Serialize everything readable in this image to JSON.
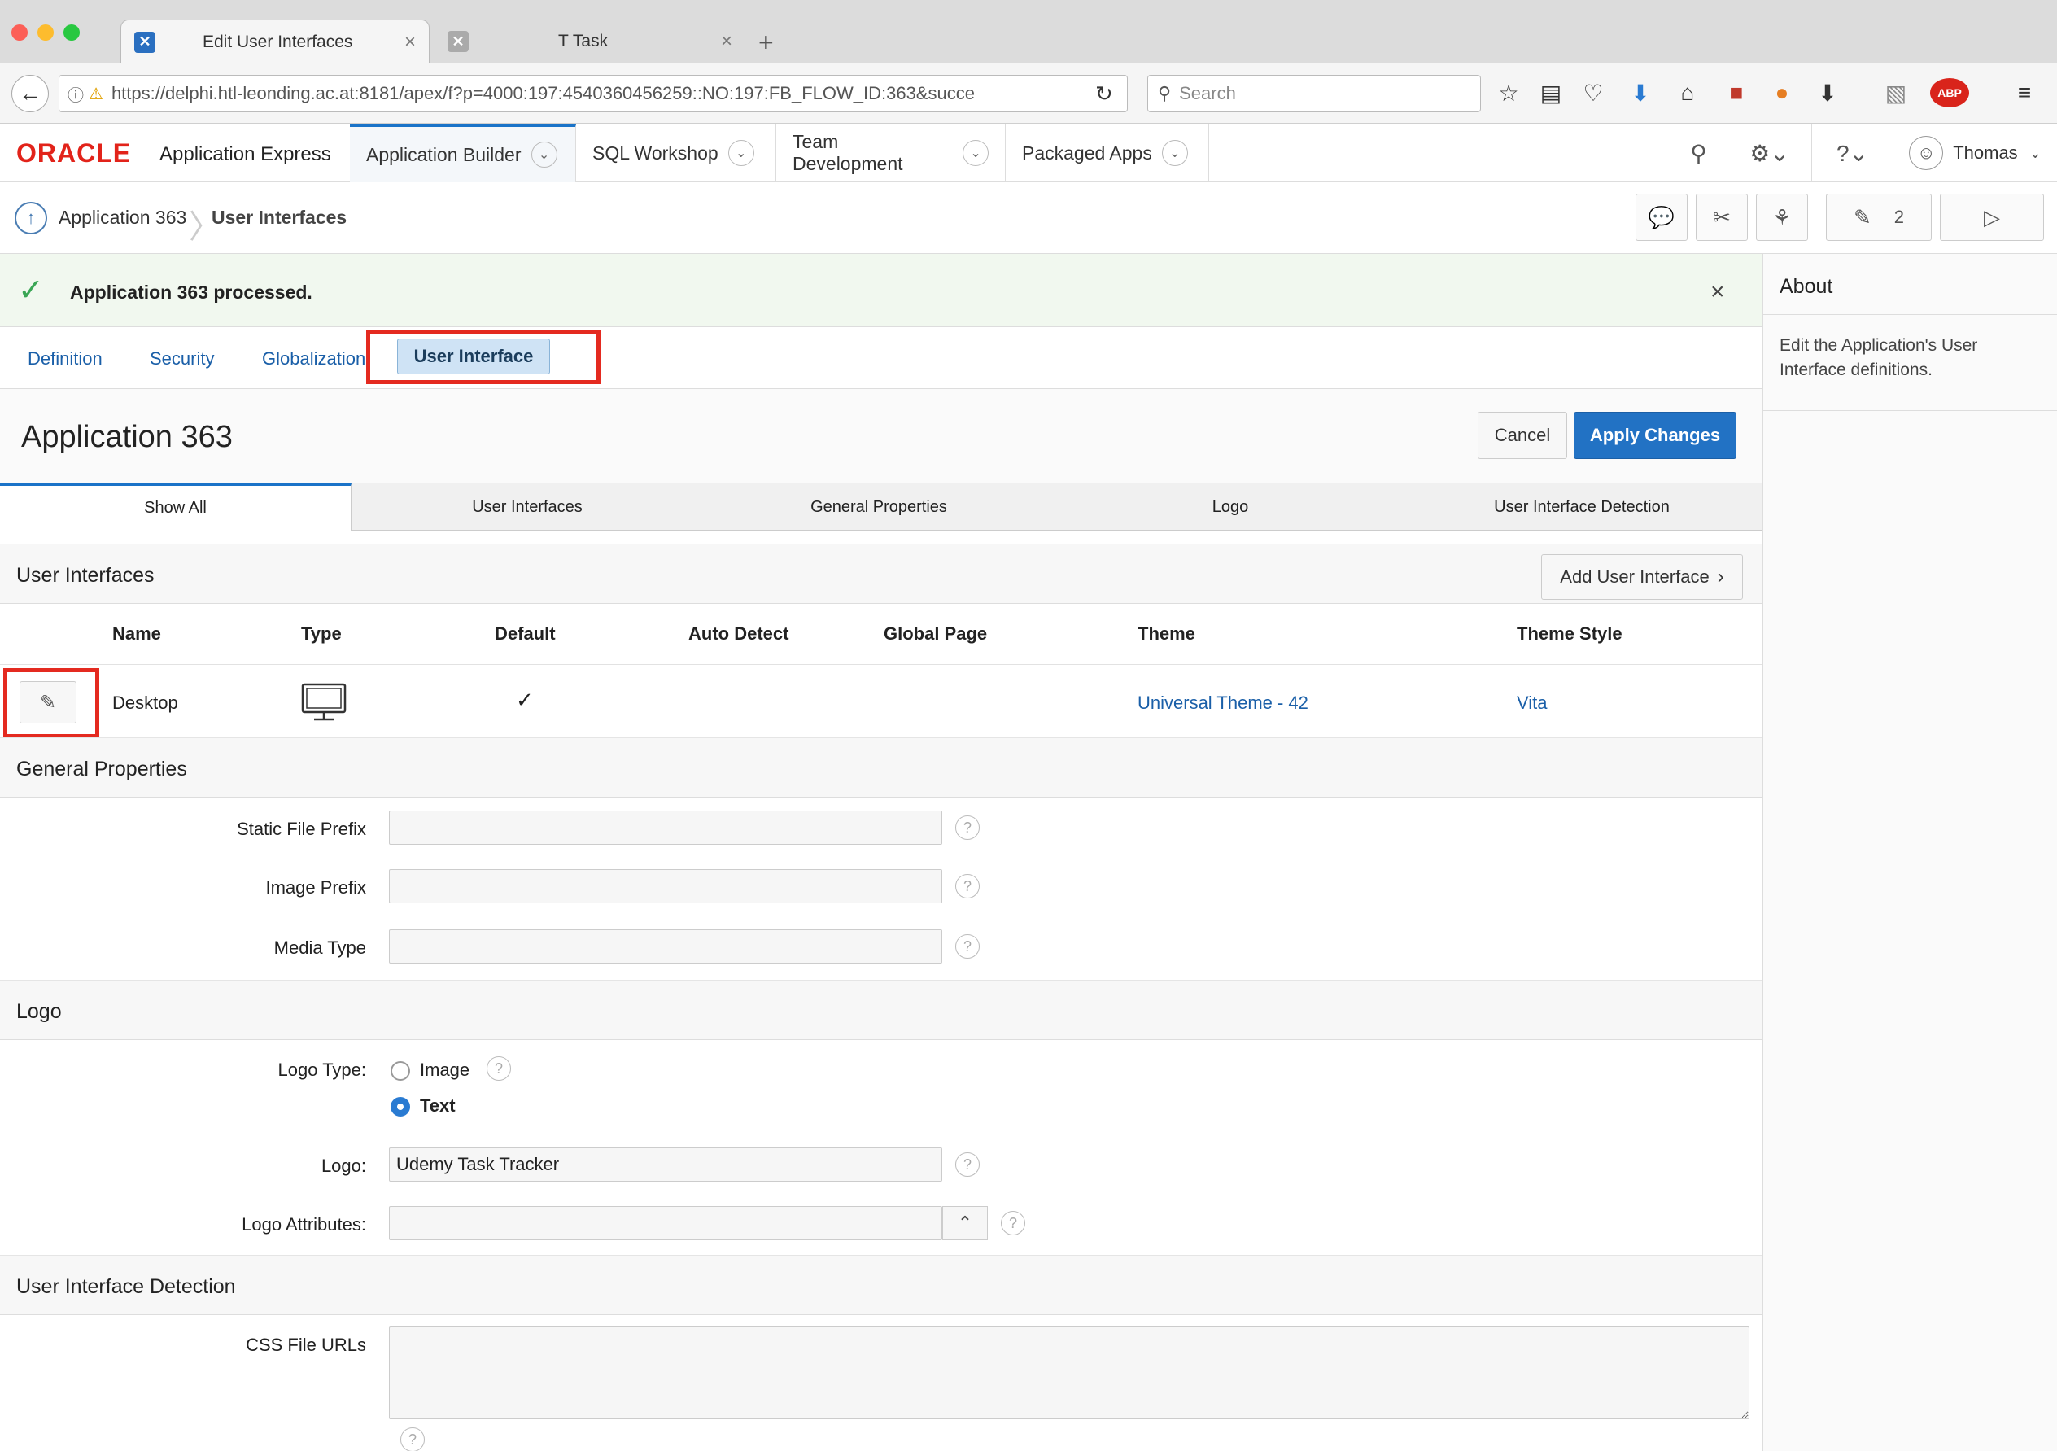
{
  "browser": {
    "tabs": [
      {
        "title": "Edit User Interfaces",
        "active": true
      },
      {
        "title": "T Task",
        "active": false
      }
    ],
    "url": "https://delphi.htl-leonding.ac.at:8181/apex/f?p=4000:197:4540360456259::NO:197:FB_FLOW_ID:363&succe",
    "search_placeholder": "Search"
  },
  "apex_header": {
    "brand": "ORACLE",
    "product": "Application Express",
    "tabs": [
      "Application Builder",
      "SQL Workshop",
      "Team Development",
      "Packaged Apps"
    ],
    "user": "Thomas"
  },
  "breadcrumb": {
    "parent": "Application 363",
    "current": "User Interfaces",
    "edit_count": "2"
  },
  "message": {
    "text": "Application 363 processed.",
    "close": "×"
  },
  "subtabs": {
    "items": [
      "Definition",
      "Security",
      "Globalization"
    ],
    "active": "User Interface"
  },
  "page": {
    "title": "Application 363",
    "cancel": "Cancel",
    "apply": "Apply Changes"
  },
  "section_tabs": [
    "Show All",
    "User Interfaces",
    "General Properties",
    "Logo",
    "User Interface Detection"
  ],
  "user_interfaces": {
    "title": "User Interfaces",
    "add_button": "Add User Interface",
    "columns": [
      "Name",
      "Type",
      "Default",
      "Auto Detect",
      "Global Page",
      "Theme",
      "Theme Style"
    ],
    "rows": [
      {
        "name": "Desktop",
        "default": "✓",
        "theme": "Universal Theme - 42",
        "theme_style": "Vita"
      }
    ]
  },
  "general_properties": {
    "title": "General Properties",
    "fields": [
      {
        "label": "Static File Prefix",
        "value": ""
      },
      {
        "label": "Image Prefix",
        "value": ""
      },
      {
        "label": "Media Type",
        "value": ""
      }
    ]
  },
  "logo": {
    "title": "Logo",
    "type_label": "Logo Type:",
    "options": [
      "Image",
      "Text"
    ],
    "selected": "Text",
    "logo_label": "Logo:",
    "logo_value": "Udemy Task Tracker",
    "attributes_label": "Logo Attributes:",
    "attributes_value": ""
  },
  "detection": {
    "title": "User Interface Detection",
    "css_label": "CSS File URLs",
    "css_value": ""
  },
  "sidebar": {
    "title": "About",
    "text": "Edit the Application's User Interface definitions."
  },
  "colors": {
    "accent": "#2272c4",
    "oracle_red": "#e2231a",
    "success_bg": "#f1f8ef",
    "annotation_red": "#e42a20"
  }
}
